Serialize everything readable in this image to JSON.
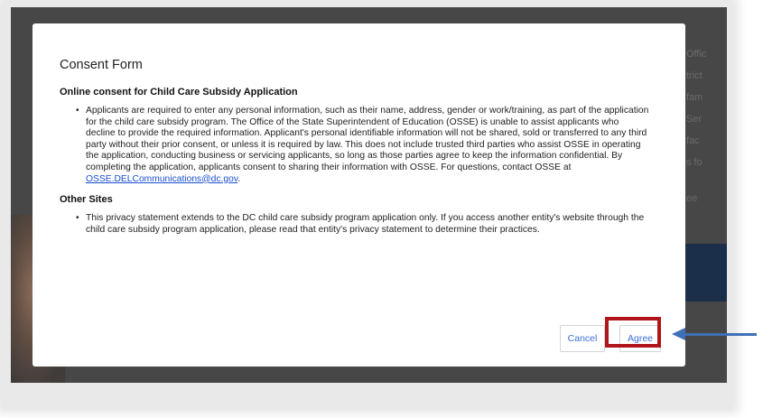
{
  "background": {
    "side_text_fragments": [
      "Offic",
      "trict",
      "fam",
      "Ser",
      "fac",
      "s fo",
      "ee"
    ]
  },
  "modal": {
    "title": "Consent Form",
    "sections": [
      {
        "heading": "Online consent for Child Care Subsidy Application",
        "paragraph": "Applicants are required to enter any personal information, such as their name, address, gender or work/training, as part of the application for the child care subsidy program. The Office of the State Superintendent of Education (OSSE) is unable to assist applicants who decline to provide the required information. Applicant's personal identifiable information will not be shared, sold or transferred to any third party without their prior consent, or unless it is required by law. This does not include trusted third parties who assist OSSE in operating the application, conducting business or servicing applicants, so long as those parties agree to keep the information confidential. By completing the application, applicants consent to sharing their information with OSSE. For questions, contact OSSE at ",
        "email": "OSSE.DELCommunications@dc.gov",
        "trailing": "."
      },
      {
        "heading": "Other Sites",
        "paragraph": "This privacy statement extends to the DC child care subsidy program application only. If you access another entity's website through the child care subsidy program application, please read that entity's privacy statement to determine their practices."
      }
    ],
    "buttons": {
      "cancel": "Cancel",
      "agree": "Agree"
    }
  },
  "annotation": {
    "highlight_color": "#b0151c",
    "arrow_color": "#3f6fb6",
    "target": "Agree"
  }
}
